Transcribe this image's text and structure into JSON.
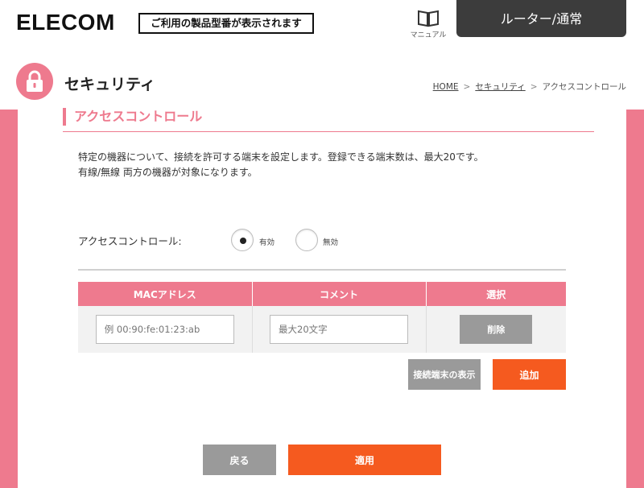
{
  "header": {
    "logo": "ELECOM",
    "logo_tag": "ご利用の製品型番が表示されます",
    "manual_label": "マニュアル",
    "mode": "ルーター/通常"
  },
  "page": {
    "title": "セキュリティ",
    "breadcrumb": {
      "home": "HOME",
      "security": "セキュリティ",
      "current": "アクセスコントロール",
      "separator": ">"
    }
  },
  "section": {
    "title": "アクセスコントロール",
    "description_line1": "特定の機器について、接続を許可する端末を設定します。登録できる端末数は、最大20です。",
    "description_line2": "有線/無線 両方の機器が対象になります。"
  },
  "access_control": {
    "label": "アクセスコントロール:",
    "options": [
      {
        "label": "有効",
        "selected": true
      },
      {
        "label": "無効",
        "selected": false
      }
    ]
  },
  "table": {
    "headers": [
      "MACアドレス",
      "コメント",
      "選択"
    ],
    "row": {
      "mac_placeholder": "例 00:90:fe:01:23:ab",
      "comment_placeholder": "最大20文字",
      "delete_label": "削除"
    }
  },
  "buttons": {
    "show_connected": "接続端末の表示",
    "add": "追加",
    "back": "戻る",
    "apply": "適用"
  },
  "colors": {
    "accent_pink": "#ee7a8e",
    "action_orange": "#f55a1f",
    "neutral_gray": "#9a9a9a",
    "header_dark": "#3c3c3c"
  }
}
